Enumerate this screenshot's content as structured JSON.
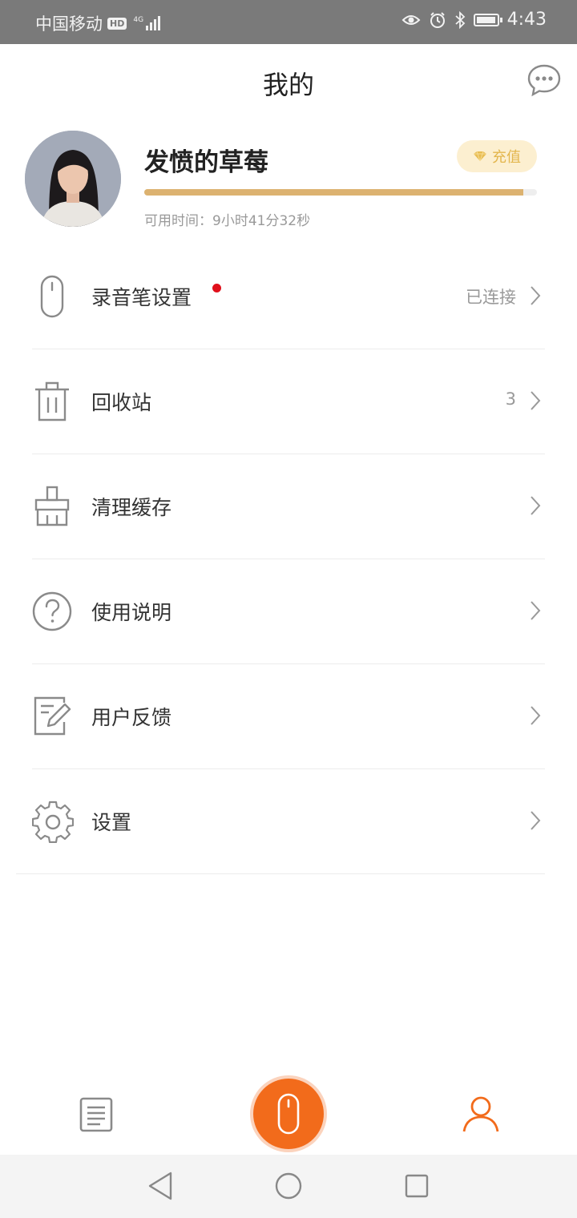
{
  "status_bar": {
    "carrier": "中国移动",
    "hd": "HD",
    "network": "4G",
    "time": "4:43",
    "icons": [
      "eye-icon",
      "alarm-icon",
      "bluetooth-icon",
      "battery-icon"
    ]
  },
  "header": {
    "title": "我的",
    "message_icon": "chat-bubble-icon"
  },
  "profile": {
    "username": "发愤的草莓",
    "recharge_label": "充值",
    "available_label": "可用时间：9小时41分32秒",
    "time_progress_fraction": 0.965,
    "accent_color": "#dcb270"
  },
  "menu": [
    {
      "icon": "recorder-pen-icon",
      "label": "录音笔设置",
      "value": "已连接",
      "has_dot": true
    },
    {
      "icon": "trash-icon",
      "label": "回收站",
      "value": "3",
      "has_dot": false
    },
    {
      "icon": "broom-icon",
      "label": "清理缓存",
      "value": "",
      "has_dot": false
    },
    {
      "icon": "help-icon",
      "label": "使用说明",
      "value": "",
      "has_dot": false
    },
    {
      "icon": "feedback-edit-icon",
      "label": "用户反馈",
      "value": "",
      "has_dot": false
    },
    {
      "icon": "gear-icon",
      "label": "设置",
      "value": "",
      "has_dot": false
    }
  ],
  "bottom_nav": {
    "items": [
      "list-icon",
      "record-icon",
      "user-icon"
    ],
    "active": "user-icon",
    "active_color": "#f26b1b"
  },
  "system_nav": [
    "back-icon",
    "home-icon",
    "recent-apps-icon"
  ]
}
